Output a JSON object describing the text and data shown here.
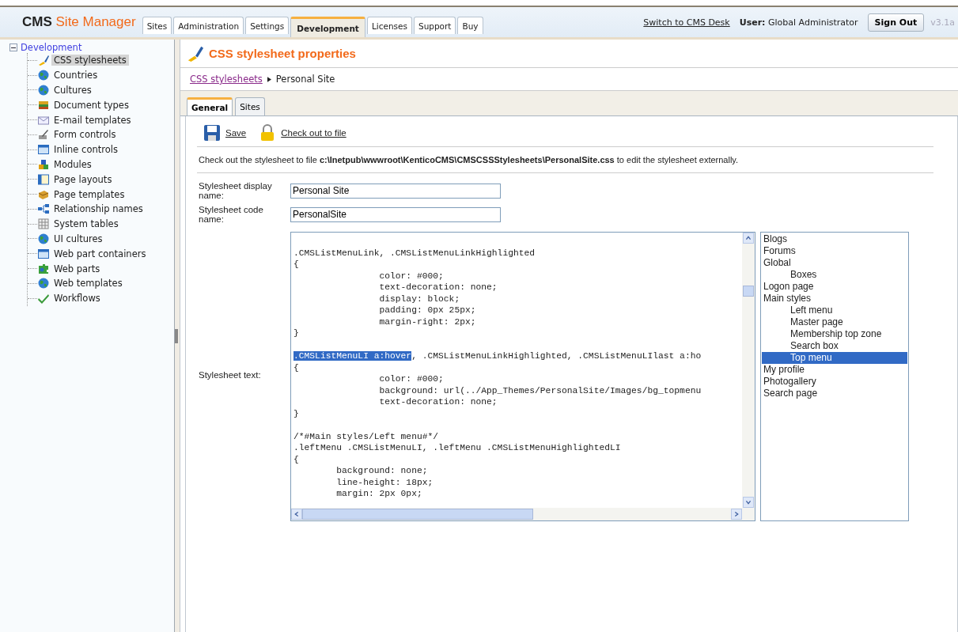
{
  "header": {
    "logo_bold": "CMS",
    "logo_rest": "Site Manager",
    "tabs": [
      {
        "label": "Sites",
        "selected": false
      },
      {
        "label": "Administration",
        "selected": false
      },
      {
        "label": "Settings",
        "selected": false
      },
      {
        "label": "Development",
        "selected": true
      },
      {
        "label": "Licenses",
        "selected": false
      },
      {
        "label": "Support",
        "selected": false
      },
      {
        "label": "Buy",
        "selected": false
      }
    ],
    "switch_link": "Switch to CMS Desk",
    "user_label": "User:",
    "user_name": "Global Administrator",
    "sign_out": "Sign Out",
    "version": "v3.1a"
  },
  "sidebar": {
    "root": {
      "label": "Development",
      "expanded": true,
      "children": [
        {
          "label": "CSS stylesheets",
          "selected": true
        },
        {
          "label": "Countries",
          "selected": false
        },
        {
          "label": "Cultures",
          "selected": false
        },
        {
          "label": "Document types",
          "selected": false
        },
        {
          "label": "E-mail templates",
          "selected": false
        },
        {
          "label": "Form controls",
          "selected": false
        },
        {
          "label": "Inline controls",
          "selected": false
        },
        {
          "label": "Modules",
          "selected": false
        },
        {
          "label": "Page layouts",
          "selected": false
        },
        {
          "label": "Page templates",
          "selected": false
        },
        {
          "label": "Relationship names",
          "selected": false
        },
        {
          "label": "System tables",
          "selected": false
        },
        {
          "label": "UI cultures",
          "selected": false
        },
        {
          "label": "Web part containers",
          "selected": false
        },
        {
          "label": "Web parts",
          "selected": false
        },
        {
          "label": "Web templates",
          "selected": false
        },
        {
          "label": "Workflows",
          "selected": false
        }
      ]
    }
  },
  "page": {
    "title": "CSS stylesheet properties",
    "breadcrumb": {
      "link": "CSS stylesheets",
      "current": "Personal Site"
    },
    "tabs": [
      {
        "label": "General",
        "selected": true
      },
      {
        "label": "Sites",
        "selected": false
      }
    ],
    "actions": [
      "Save",
      "Check out to file"
    ],
    "info": "Check out the stylesheet to file **c:\\Inetpub\\wwwroot\\KenticoCMS\\CMSCSSStylesheets\\PersonalSite.css** to edit the stylesheet externally.",
    "fields": [
      {
        "label": "Stylesheet display name:",
        "value": "Personal Site"
      },
      {
        "label": "Stylesheet code name:",
        "value": "PersonalSite"
      }
    ],
    "text_label": "Stylesheet text:",
    "code_blocks": [
      [
        {
          "text": ".CMSListMenuLink, .CMSListMenuLinkHighlighted"
        },
        {
          "text": "{"
        },
        {
          "text": "                color: #000;"
        },
        {
          "text": "                text-decoration: none;"
        },
        {
          "text": "                display: block;"
        },
        {
          "text": "                padding: 0px 25px;"
        },
        {
          "text": "                margin-right: 2px;"
        },
        {
          "text": "}"
        }
      ],
      [
        {
          "selection": ".CMSListMenuLI a:hover",
          "text": ", .CMSListMenuLinkHighlighted, .CMSListMenuLIlast a:ho"
        },
        {
          "text": "{"
        },
        {
          "text": "                color: #000;"
        },
        {
          "text": "                background: url(../App_Themes/PersonalSite/Images/bg_topmenu"
        },
        {
          "text": "                text-decoration: none;"
        },
        {
          "text": "}"
        }
      ],
      [
        {
          "text": "/*#Main styles/Left menu#*/"
        },
        {
          "text": ".leftMenu .CMSListMenuLI, .leftMenu .CMSListMenuHighlightedLI"
        },
        {
          "text": "{"
        },
        {
          "text": "        background: none;"
        },
        {
          "text": "        line-height: 18px;"
        },
        {
          "text": "        margin: 2px 0px;"
        }
      ]
    ],
    "styles": [
      {
        "label": "Blogs",
        "selected": false
      },
      {
        "label": "Forums",
        "selected": false
      },
      {
        "label": "Global",
        "selected": false,
        "children": [
          {
            "label": "Boxes",
            "selected": false
          }
        ]
      },
      {
        "label": "Logon page",
        "selected": false
      },
      {
        "label": "Main styles",
        "selected": false,
        "children": [
          {
            "label": "Left menu",
            "selected": false
          },
          {
            "label": "Master page",
            "selected": false
          },
          {
            "label": "Membership top zone",
            "selected": false
          },
          {
            "label": "Search box",
            "selected": false
          },
          {
            "label": "Top menu",
            "selected": true
          }
        ]
      },
      {
        "label": "My profile",
        "selected": false
      },
      {
        "label": "Photogallery",
        "selected": false
      },
      {
        "label": "Search page",
        "selected": false
      }
    ]
  }
}
